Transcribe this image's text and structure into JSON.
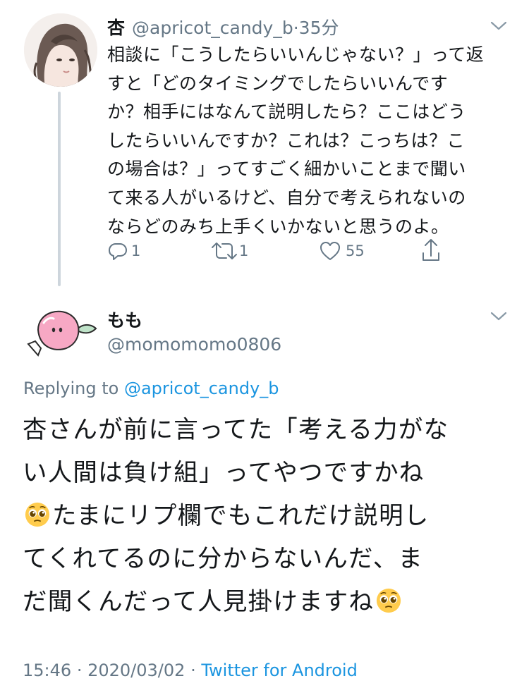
{
  "parent_tweet": {
    "display_name": "杏",
    "handle": "@apricot_candy_b",
    "separator": "·",
    "time": "35分",
    "text_lines": [
      "相談に「こうしたらいいんじゃない？」って返",
      "すと「どのタイミングでしたらいいんです",
      "か？相手にはなんて説明したら？ここはどう",
      "したらいいんですか？これは？こっちは？こ",
      "の場合は？」ってすごく細かいことまで聞い",
      "て来る人がいるけど、自分で考えられないの",
      "ならどのみち上手くいかないと思うのよ。"
    ],
    "avatar_icon": "woman-portrait-illustration",
    "actions": {
      "reply_count": "1",
      "retweet_count": "1",
      "like_count": "55",
      "reply_icon": "reply-icon",
      "retweet_icon": "retweet-icon",
      "like_icon": "heart-icon",
      "share_icon": "share-icon"
    }
  },
  "main_tweet": {
    "display_name": "もも",
    "handle": "@momomomo0806",
    "avatar_icon": "peach-illustration",
    "replying_prefix": "Replying to",
    "replying_handle": "@apricot_candy_b",
    "text_parts": {
      "line1": "杏さんが前に言ってた「考える力がな",
      "line2": "い人間は負け組」ってやつですかね",
      "line3_after_emoji": "たまにリプ欄でもこれだけ説明し",
      "line4": "てくれてるのに分からないんだ、ま",
      "line5": "だ聞くんだって人見掛けますね"
    },
    "emoji_name": "pleading-face-emoji",
    "time": "15:46",
    "meta_separator": "·",
    "date": "2020/03/02",
    "source": "Twitter for Android"
  },
  "colors": {
    "text": "#14171a",
    "muted": "#657786",
    "link": "#1b95e0",
    "thread_line": "#cdd5dc"
  }
}
